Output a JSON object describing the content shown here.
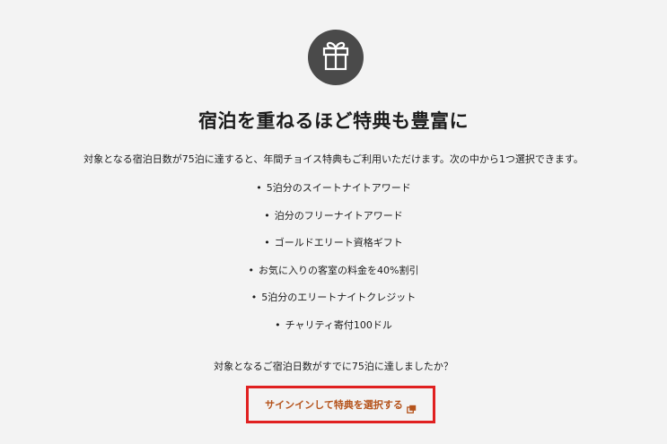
{
  "title": "宿泊を重ねるほど特典も豊富に",
  "description": "対象となる宿泊日数が75泊に達すると、年間チョイス特典もご利用いただけます。次の中から1つ選択できます。",
  "benefits": [
    "5泊分のスイートナイトアワード",
    "泊分のフリーナイトアワード",
    "ゴールドエリート資格ギフト",
    "お気に入りの客室の料金を40%割引",
    "5泊分のエリートナイトクレジット",
    "チャリティ寄付100ドル"
  ],
  "bullet": "•",
  "question": "対象となるご宿泊日数がすでに75泊に達しましたか？",
  "signin_label": "サインインして特典を選択する",
  "icons": {
    "gift": "gift-icon",
    "external": "external-window-icon"
  },
  "colors": {
    "background": "#f3f3f3",
    "icon_circle": "#4a4a4a",
    "link_text": "#b5531b",
    "highlight_border": "#e02020"
  }
}
